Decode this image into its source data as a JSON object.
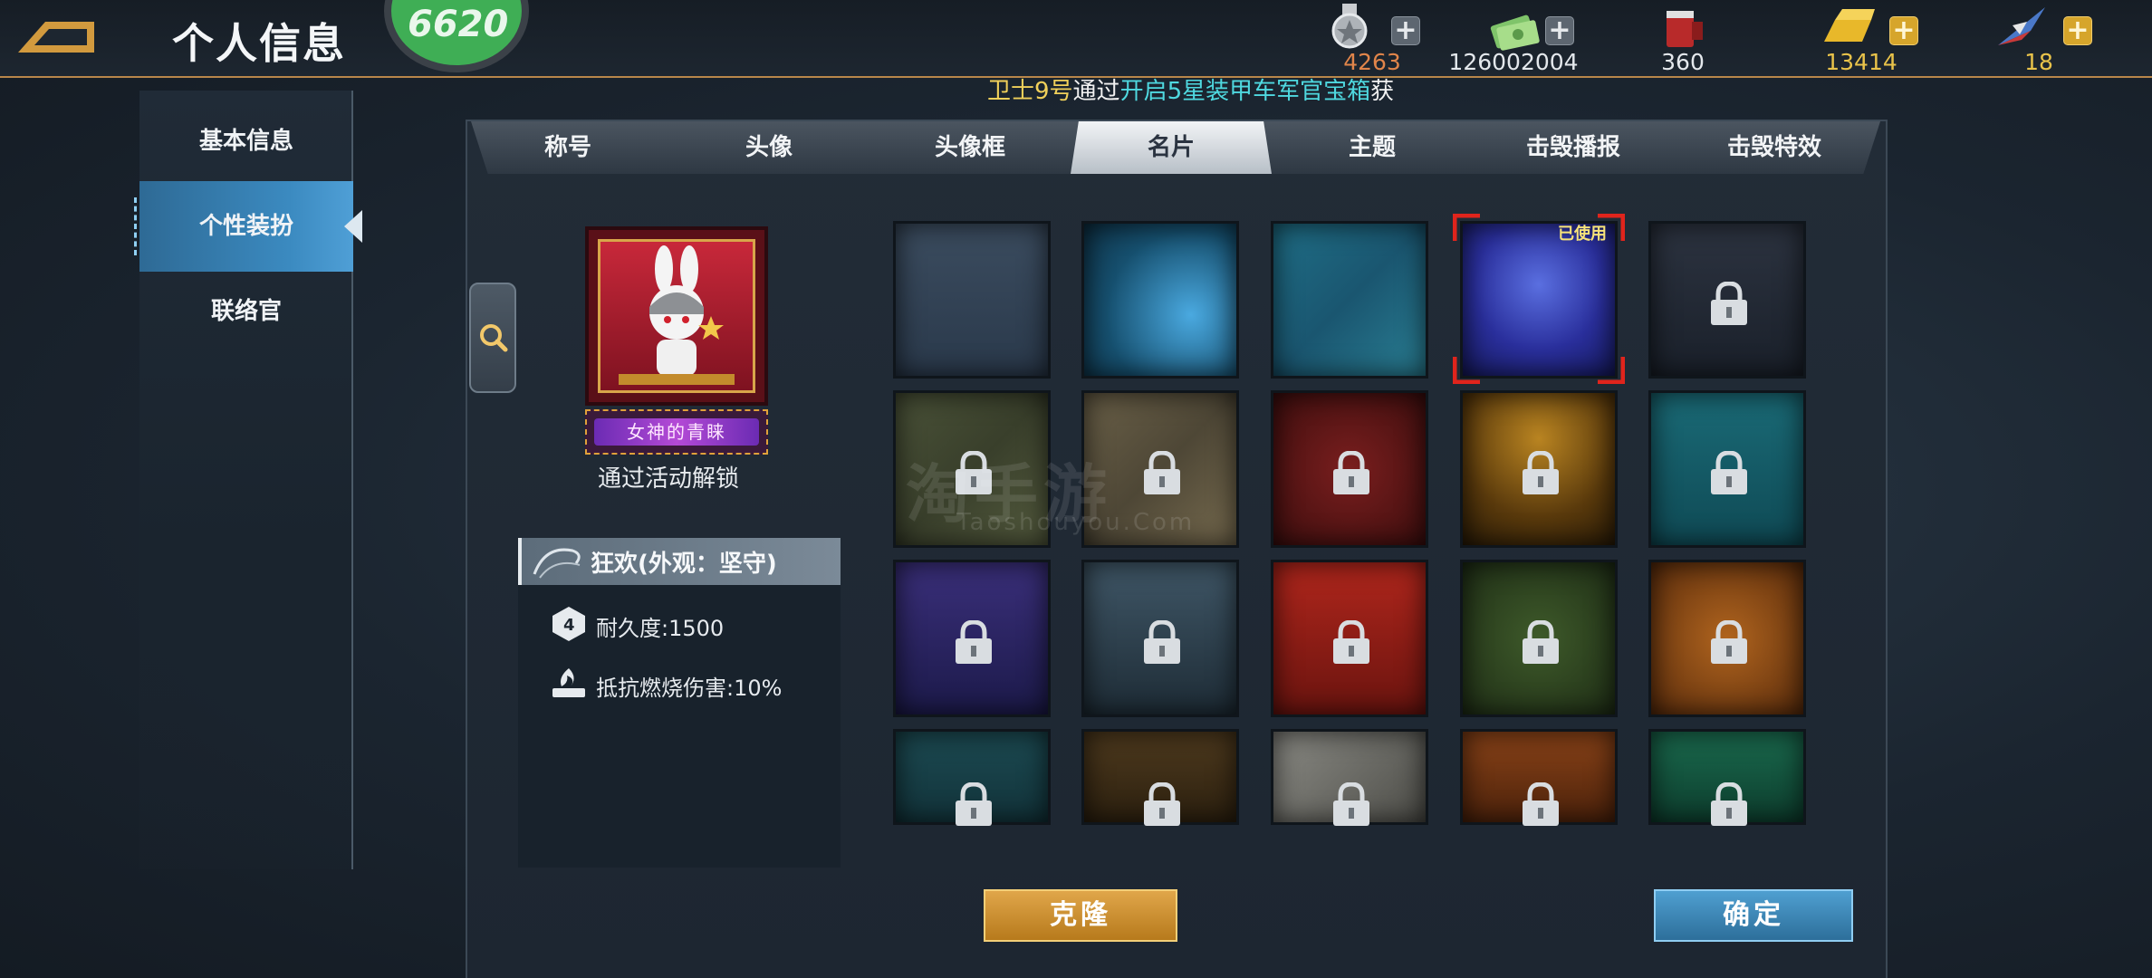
{
  "header": {
    "title": "个人信息",
    "emblem_text": "6620"
  },
  "resources": [
    {
      "name": "medal",
      "icon": "medal-icon",
      "value": "4263",
      "color": "#e1854a",
      "has_plus": true,
      "plus_style": "grey"
    },
    {
      "name": "cash",
      "icon": "cash-icon",
      "value": "126002004",
      "color": "#e4e8ec",
      "has_plus": true,
      "plus_style": "grey"
    },
    {
      "name": "paint",
      "icon": "paint-bucket-icon",
      "value": "360",
      "color": "#e4e8ec",
      "has_plus": false
    },
    {
      "name": "gold",
      "icon": "gold-bar-icon",
      "value": "13414",
      "color": "#e9c34a",
      "has_plus": true,
      "plus_style": "gold"
    },
    {
      "name": "jet",
      "icon": "jet-icon",
      "value": "18",
      "color": "#e9c34a",
      "has_plus": true,
      "plus_style": "gold"
    }
  ],
  "ticker": {
    "player": "卫士9号",
    "verb": "通过",
    "action": "开启5星装甲车军官宝箱",
    "tail": "获"
  },
  "sidebar": {
    "items": [
      {
        "label": "基本信息",
        "active": false
      },
      {
        "label": "个性装扮",
        "active": true
      },
      {
        "label": "联络官",
        "active": false
      }
    ]
  },
  "tabs": [
    {
      "label": "称号",
      "active": false
    },
    {
      "label": "头像",
      "active": false
    },
    {
      "label": "头像框",
      "active": false
    },
    {
      "label": "名片",
      "active": true
    },
    {
      "label": "主题",
      "active": false
    },
    {
      "label": "击毁播报",
      "active": false
    },
    {
      "label": "击毁特效",
      "active": false
    }
  ],
  "preview": {
    "nameplate_text": "女神的青睐",
    "unlock_text": "通过活动解锁",
    "card_title": "狂欢(外观：坚守)",
    "stats": [
      {
        "icon": "armor-shield-icon",
        "label": "耐久度:1500"
      },
      {
        "icon": "fire-resist-icon",
        "label": "抵抗燃烧伤害:10%"
      }
    ]
  },
  "cards": [
    {
      "name": "hex-grid-blue",
      "locked": false,
      "used": false,
      "bg": "linear-gradient(#3b4c5f,#2a394b)"
    },
    {
      "name": "hex-cyber-teal",
      "locked": false,
      "used": false,
      "bg": "radial-gradient(circle at 70% 60%,#4aa9e0,#16506f 60%,#0e3247)"
    },
    {
      "name": "circuit-teal",
      "locked": false,
      "used": false,
      "bg": "linear-gradient(135deg,#1f6e86,#1a5670,#2a7f94)"
    },
    {
      "name": "galaxy-blue",
      "locked": false,
      "used": true,
      "bg": "radial-gradient(circle at 50% 40%,#5a6fe0,#2a2f9c 55%,#161a60)"
    },
    {
      "name": "star-dark",
      "locked": true,
      "used": false,
      "bg": "linear-gradient(#2c3340,#1a202a)"
    },
    {
      "name": "camo-green",
      "locked": true,
      "used": false,
      "bg": "linear-gradient(135deg,#4a5238,#393f2b,#545b3e)"
    },
    {
      "name": "camo-sand",
      "locked": true,
      "used": false,
      "bg": "linear-gradient(135deg,#6a6048,#4e4736,#776b4f)"
    },
    {
      "name": "crimson",
      "locked": true,
      "used": false,
      "bg": "radial-gradient(circle,#7a1e1e,#3d0e0e)"
    },
    {
      "name": "amber-glow",
      "locked": true,
      "used": false,
      "bg": "radial-gradient(circle at 50% 30%,#b98421,#5a3a0c 60%,#2b1c07)"
    },
    {
      "name": "teal-waves",
      "locked": true,
      "used": false,
      "bg": "linear-gradient(#1a6a76,#0f4a55)"
    },
    {
      "name": "night-purple",
      "locked": true,
      "used": false,
      "bg": "linear-gradient(#3a2f7a,#1c1a4a)"
    },
    {
      "name": "tank-silhouette",
      "locked": true,
      "used": false,
      "bg": "linear-gradient(#3f5666,#1e2c36)"
    },
    {
      "name": "star-flag",
      "locked": true,
      "used": false,
      "bg": "linear-gradient(#b0261c,#6a140f)"
    },
    {
      "name": "floral-green",
      "locked": true,
      "used": false,
      "bg": "radial-gradient(circle,#3e5a2a,#1f2e16)"
    },
    {
      "name": "autumn-leaves",
      "locked": true,
      "used": false,
      "bg": "radial-gradient(circle,#b0641e,#5a2c0c)"
    },
    {
      "name": "leaf-teal",
      "locked": true,
      "used": false,
      "bg": "linear-gradient(#1c4a52,#12333a)"
    },
    {
      "name": "stars-bronze",
      "locked": true,
      "used": false,
      "bg": "linear-gradient(#4e3a1e,#2c200f)"
    },
    {
      "name": "stripe-grey",
      "locked": true,
      "used": false,
      "bg": "linear-gradient(135deg,#8a8a84,#4d4d48)"
    },
    {
      "name": "swirl-orange",
      "locked": true,
      "used": false,
      "bg": "linear-gradient(#8a4318,#4c220b)"
    },
    {
      "name": "emerald",
      "locked": true,
      "used": false,
      "bg": "linear-gradient(#1a6a4e,#0d3d2d)"
    }
  ],
  "used_badge": "已使用",
  "watermark": {
    "main": "淘手游",
    "sub": "Taoshouyou.Com"
  },
  "buttons": {
    "clone": "克隆",
    "confirm": "确定"
  },
  "colors": {
    "accent_orange": "#b8864a",
    "active_blue": "#3b8ac0",
    "select_red": "#e0241c",
    "clone_gold": "#d59a3a",
    "confirm_blue": "#3f87b8"
  }
}
